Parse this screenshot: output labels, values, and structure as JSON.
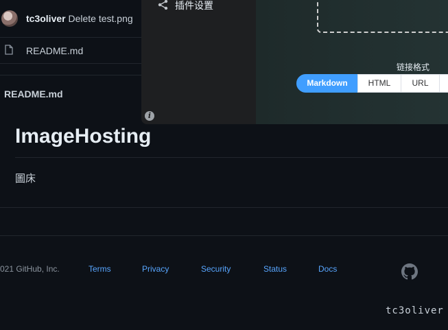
{
  "commit": {
    "author": "tc3oliver",
    "message": "Delete test.png"
  },
  "files": [
    {
      "name": "README.md",
      "icon": "file-icon"
    }
  ],
  "readme": {
    "label": "README.md",
    "title": "ImageHosting",
    "description": "圖床"
  },
  "footer": {
    "copyright": "021 GitHub, Inc.",
    "links": [
      "Terms",
      "Privacy",
      "Security",
      "Status",
      "Docs"
    ],
    "logo_icon": "github-logo-icon"
  },
  "owner": "tc3oliver",
  "plugin": {
    "settings_label": "插件设置",
    "format_label": "链接格式",
    "formats": [
      "Markdown",
      "HTML",
      "URL"
    ],
    "selected_format": "Markdown",
    "accent": "#409eff"
  },
  "colors": {
    "background": "#0d1117",
    "link": "#58a6ff",
    "border": "#21262d"
  }
}
